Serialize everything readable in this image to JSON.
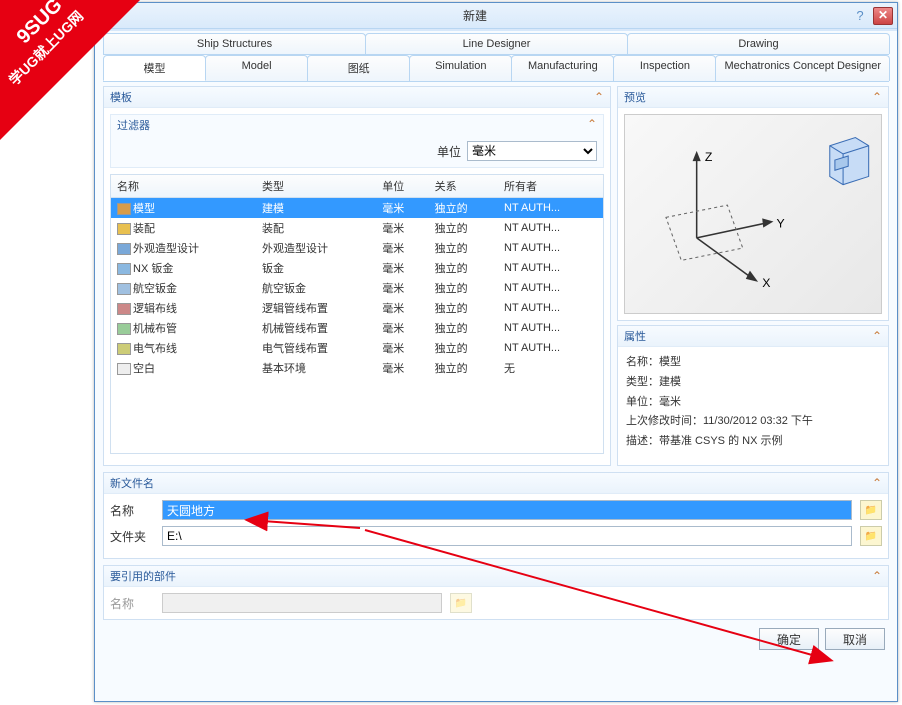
{
  "watermark": {
    "line1": "9SUG",
    "line2": "学UG就上UG网"
  },
  "window": {
    "title": "新建"
  },
  "tabs_row1": [
    "Ship Structures",
    "Line Designer",
    "Drawing"
  ],
  "tabs_row2": [
    "模型",
    "Model",
    "图纸",
    "Simulation",
    "Manufacturing",
    "Inspection",
    "Mechatronics Concept Designer"
  ],
  "active_tab": "模型",
  "templates": {
    "header": "模板",
    "filter": {
      "header": "过滤器",
      "unit_label": "单位",
      "unit_value": "毫米"
    },
    "columns": [
      "名称",
      "类型",
      "单位",
      "关系",
      "所有者"
    ],
    "rows": [
      {
        "icon": "model-icon",
        "name": "模型",
        "type": "建模",
        "unit": "毫米",
        "rel": "独立的",
        "owner": "NT AUTH...",
        "selected": true
      },
      {
        "icon": "assembly-icon",
        "name": "装配",
        "type": "装配",
        "unit": "毫米",
        "rel": "独立的",
        "owner": "NT AUTH..."
      },
      {
        "icon": "shape-icon",
        "name": "外观造型设计",
        "type": "外观造型设计",
        "unit": "毫米",
        "rel": "独立的",
        "owner": "NT AUTH..."
      },
      {
        "icon": "sheet-icon",
        "name": "NX 钣金",
        "type": "钣金",
        "unit": "毫米",
        "rel": "独立的",
        "owner": "NT AUTH..."
      },
      {
        "icon": "aero-icon",
        "name": "航空钣金",
        "type": "航空钣金",
        "unit": "毫米",
        "rel": "独立的",
        "owner": "NT AUTH..."
      },
      {
        "icon": "logic-icon",
        "name": "逻辑布线",
        "type": "逻辑管线布置",
        "unit": "毫米",
        "rel": "独立的",
        "owner": "NT AUTH..."
      },
      {
        "icon": "mech-icon",
        "name": "机械布管",
        "type": "机械管线布置",
        "unit": "毫米",
        "rel": "独立的",
        "owner": "NT AUTH..."
      },
      {
        "icon": "elec-icon",
        "name": "电气布线",
        "type": "电气管线布置",
        "unit": "毫米",
        "rel": "独立的",
        "owner": "NT AUTH..."
      },
      {
        "icon": "blank-icon",
        "name": "空白",
        "type": "基本环境",
        "unit": "毫米",
        "rel": "独立的",
        "owner": "无"
      }
    ]
  },
  "preview": {
    "header": "预览",
    "axes": {
      "x": "X",
      "y": "Y",
      "z": "Z"
    }
  },
  "properties": {
    "header": "属性",
    "lines": {
      "name": "名称：模型",
      "type": "类型：建模",
      "unit": "单位：毫米",
      "modified": "上次修改时间：11/30/2012 03:32 下午",
      "desc": "描述：带基准 CSYS 的 NX 示例"
    }
  },
  "newfile": {
    "header": "新文件名",
    "name_label": "名称",
    "name_value": "天圆地方",
    "folder_label": "文件夹",
    "folder_value": "E:\\"
  },
  "refpart": {
    "header": "要引用的部件",
    "name_label": "名称",
    "name_value": ""
  },
  "buttons": {
    "ok": "确定",
    "cancel": "取消"
  }
}
